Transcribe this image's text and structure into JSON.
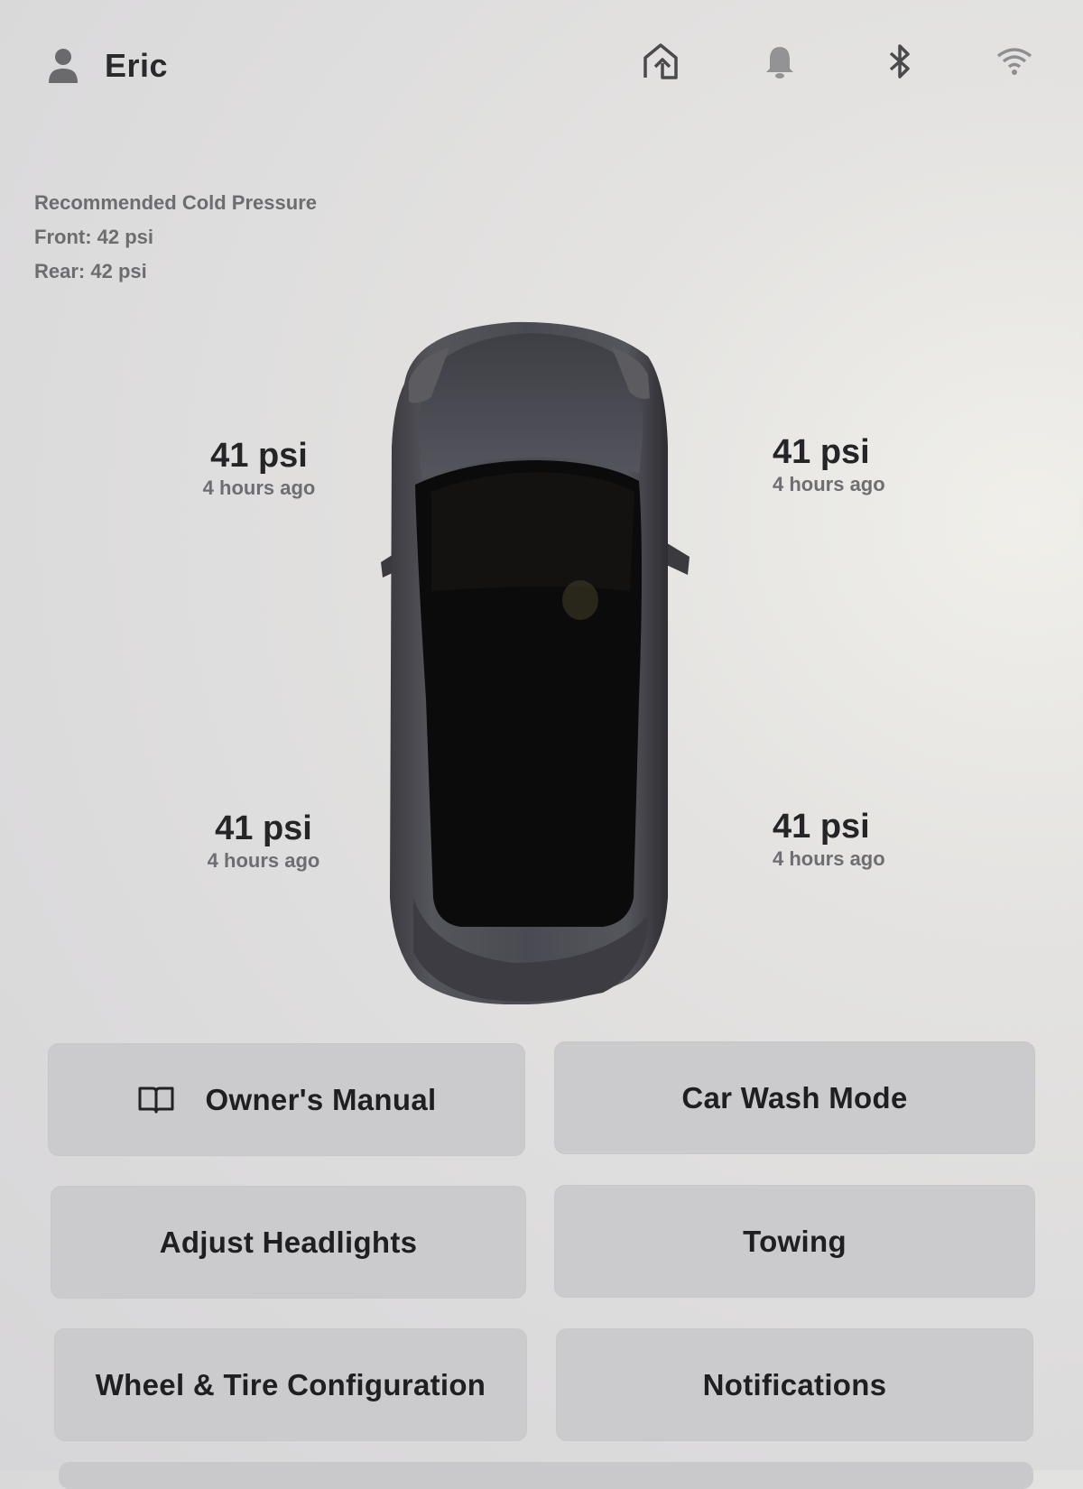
{
  "header": {
    "user_name": "Eric",
    "icons": [
      "user-icon",
      "home-upload-icon",
      "bell-icon",
      "bluetooth-icon",
      "wifi-icon"
    ]
  },
  "recommended": {
    "title": "Recommended Cold Pressure",
    "front": "Front: 42 psi",
    "rear": "Rear: 42 psi"
  },
  "tires": {
    "front_left": {
      "pressure": "41 psi",
      "updated": "4 hours ago"
    },
    "front_right": {
      "pressure": "41 psi",
      "updated": "4 hours ago"
    },
    "rear_left": {
      "pressure": "41 psi",
      "updated": "4 hours ago"
    },
    "rear_right": {
      "pressure": "41 psi",
      "updated": "4 hours ago"
    }
  },
  "buttons": {
    "owners_manual": "Owner's Manual",
    "car_wash_mode": "Car Wash Mode",
    "adjust_headlights": "Adjust Headlights",
    "towing": "Towing",
    "wheel_tire_config": "Wheel & Tire Configuration",
    "notifications": "Notifications"
  }
}
